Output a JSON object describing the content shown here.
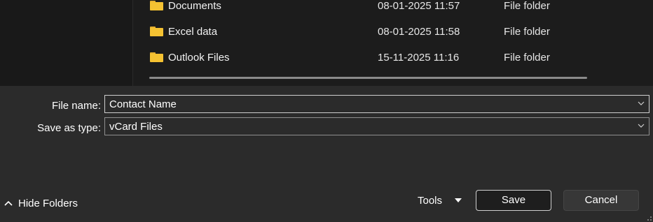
{
  "file_list": {
    "rows": [
      {
        "name": "Documents",
        "date": "08-01-2025 11:57",
        "type": "File folder"
      },
      {
        "name": "Excel data",
        "date": "08-01-2025 11:58",
        "type": "File folder"
      },
      {
        "name": "Outlook Files",
        "date": "15-11-2025 11:16",
        "type": "File folder"
      }
    ]
  },
  "form": {
    "file_name_label": "File name:",
    "file_name_value": "Contact Name",
    "save_type_label": "Save as type:",
    "save_type_value": "vCard Files"
  },
  "footer": {
    "hide_folders_label": "Hide Folders",
    "tools_label": "Tools",
    "save_label": "Save",
    "cancel_label": "Cancel"
  },
  "icons": {
    "folder": "folder-icon",
    "dropdown": "chevron-down-icon",
    "hide": "chevron-up-icon",
    "tools": "caret-down-icon"
  },
  "colors": {
    "folder": "#f5c232",
    "background": "#2b2b2b",
    "list_background": "#1c1c1c"
  }
}
